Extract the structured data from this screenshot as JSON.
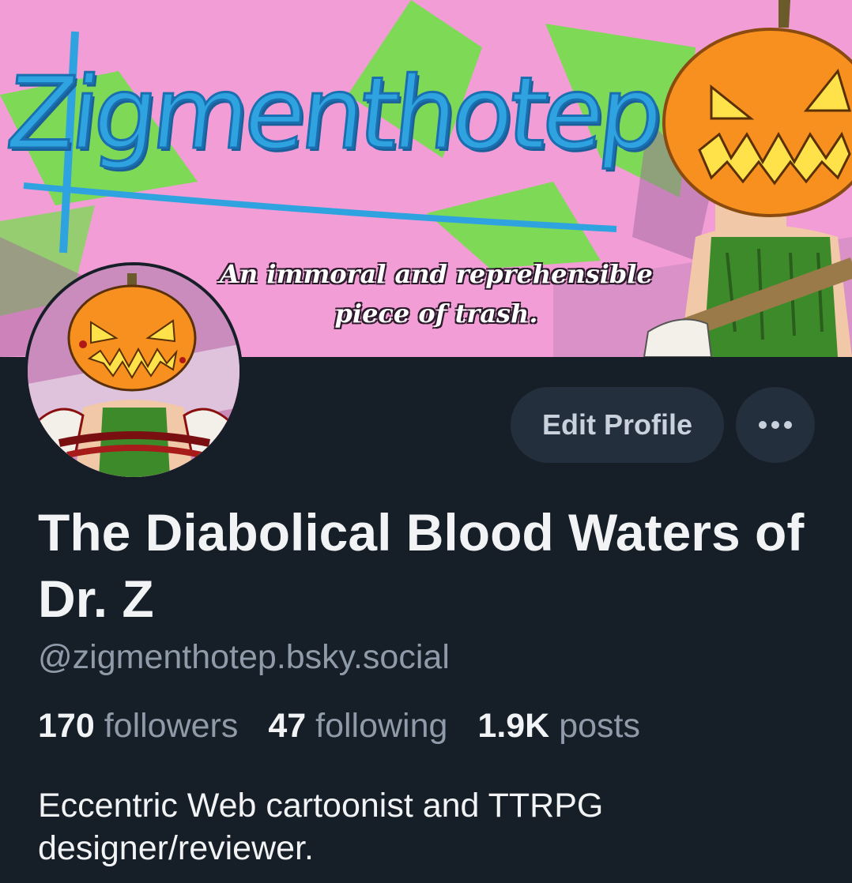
{
  "banner": {
    "wordmark": "Zigmenthotep",
    "tagline_line1": "An immoral and reprehensible",
    "tagline_line2": "piece of trash."
  },
  "profile": {
    "edit_label": "Edit Profile",
    "more_label": "•••",
    "display_name": "The Diabolical Blood Waters of Dr. Z",
    "handle": "@zigmenthotep.bsky.social",
    "stats": {
      "followers_count": "170",
      "followers_label": "followers",
      "following_count": "47",
      "following_label": "following",
      "posts_count": "1.9K",
      "posts_label": "posts"
    },
    "bio_line1": "Eccentric Web cartoonist and TTRPG",
    "bio_line2": "designer/reviewer."
  },
  "colors": {
    "background": "#161e27",
    "banner_pink": "#f29dd6",
    "banner_green": "#7ed957",
    "wordmark_blue": "#2fa3e0",
    "pumpkin_orange": "#f7901e",
    "button_bg": "#232f3c"
  }
}
